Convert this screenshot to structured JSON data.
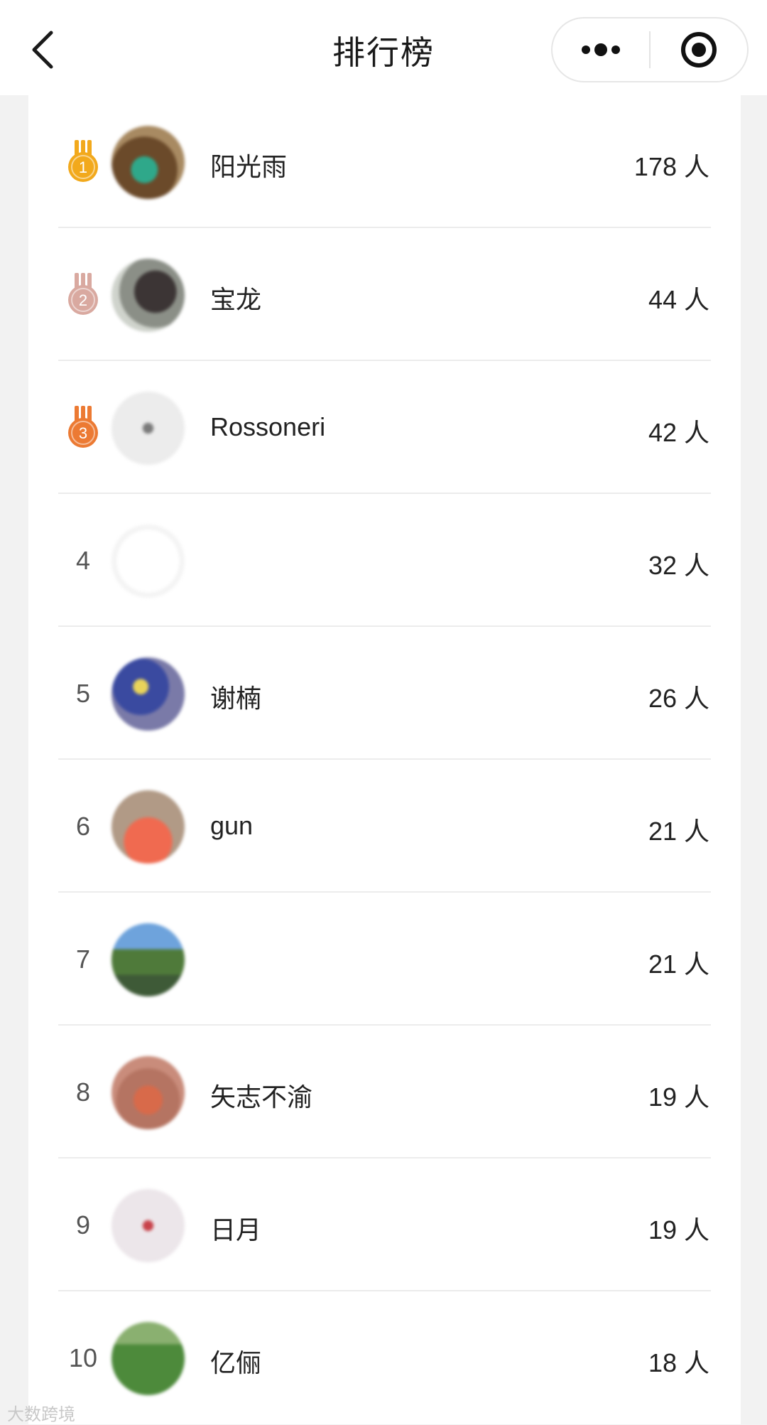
{
  "header": {
    "title": "排行榜",
    "back_icon": "chevron-left-icon",
    "more_icon": "more-dots-icon",
    "close_icon": "target-circle-icon"
  },
  "leaderboard": [
    {
      "rank": "1",
      "medal": "gold",
      "name": "阳光雨",
      "count": "178 人"
    },
    {
      "rank": "2",
      "medal": "silver",
      "name": "宝龙",
      "count": "44 人"
    },
    {
      "rank": "3",
      "medal": "bronze",
      "name": "Rossoneri",
      "count": "42 人"
    },
    {
      "rank": "4",
      "medal": "",
      "name": "",
      "count": "32 人"
    },
    {
      "rank": "5",
      "medal": "",
      "name": "谢楠",
      "count": "26 人"
    },
    {
      "rank": "6",
      "medal": "",
      "name": "gun",
      "count": "21 人"
    },
    {
      "rank": "7",
      "medal": "",
      "name": "",
      "count": "21 人"
    },
    {
      "rank": "8",
      "medal": "",
      "name": "矢志不渝",
      "count": "19 人"
    },
    {
      "rank": "9",
      "medal": "",
      "name": "日月",
      "count": "19 人"
    },
    {
      "rank": "10",
      "medal": "",
      "name": "亿俪",
      "count": "18 人"
    }
  ],
  "colors": {
    "gold": "#f2a91c",
    "silver": "#d9a9a0",
    "bronze": "#ec7a33"
  },
  "watermark": "大数跨境"
}
